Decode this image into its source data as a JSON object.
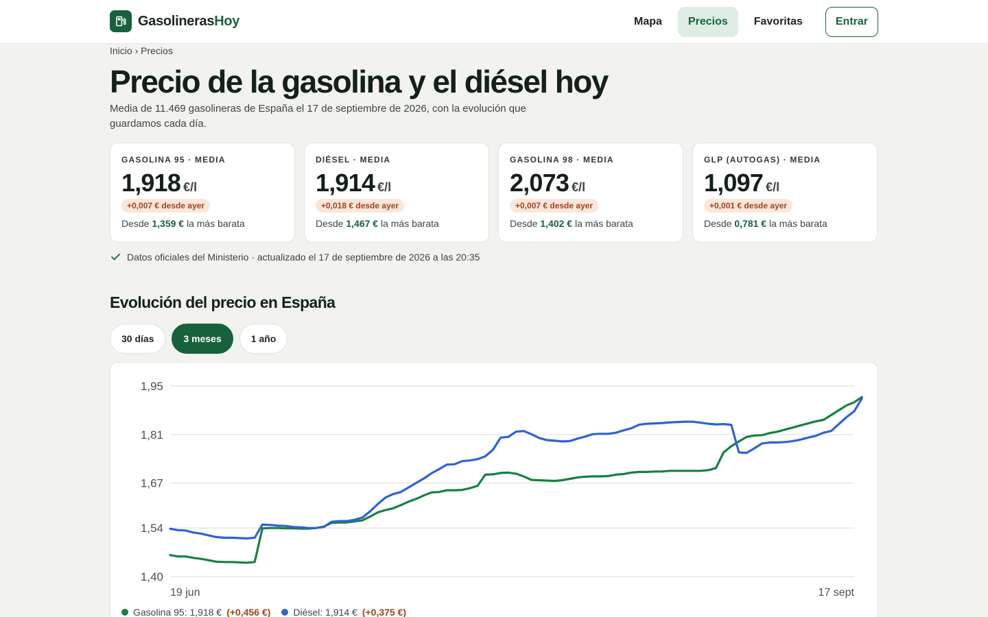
{
  "brand": {
    "name_part1": "Gasolineras",
    "name_part2": "Hoy"
  },
  "nav": {
    "items": [
      "Mapa",
      "Precios",
      "Favoritas"
    ],
    "active": "Precios",
    "login": "Entrar"
  },
  "breadcrumb": {
    "home": "Inicio",
    "separator": "›",
    "current": "Precios"
  },
  "header": {
    "title": "Precio de la gasolina y el diésel hoy",
    "subtitle": "Media de 11.469 gasolineras de España el 17 de septiembre de 2026, con la evolución que guardamos cada día."
  },
  "cards": [
    {
      "label": "GASOLINA 95 · MEDIA",
      "price": "1,918",
      "unit": "€/l",
      "delta": "+0,007 € desde ayer",
      "min_prefix": "Desde",
      "min_value": "1,359 €",
      "min_suffix": "la más barata"
    },
    {
      "label": "DIÉSEL · MEDIA",
      "price": "1,914",
      "unit": "€/l",
      "delta": "+0,018 € desde ayer",
      "min_prefix": "Desde",
      "min_value": "1,467 €",
      "min_suffix": "la más barata"
    },
    {
      "label": "GASOLINA 98 · MEDIA",
      "price": "2,073",
      "unit": "€/l",
      "delta": "+0,007 € desde ayer",
      "min_prefix": "Desde",
      "min_value": "1,402 €",
      "min_suffix": "la más barata"
    },
    {
      "label": "GLP (AUTOGAS) · MEDIA",
      "price": "1,097",
      "unit": "€/l",
      "delta": "+0,001 € desde ayer",
      "min_prefix": "Desde",
      "min_value": "0,781 €",
      "min_suffix": "la más barata"
    }
  ],
  "official_note": "Datos oficiales del Ministerio · actualizado el 17 de septiembre de 2026 a las 20:35",
  "section": {
    "title": "Evolución del precio en España"
  },
  "ranges": {
    "items": [
      "30 días",
      "3 meses",
      "1 año"
    ],
    "active": "3 meses"
  },
  "colors": {
    "accent": "#17623d",
    "gasolina95": "#17803f",
    "diesel": "#2e62d4",
    "delta": "#a2431a",
    "delta_bg": "#fbe6da"
  },
  "icons": {
    "brand": "fuel-pump-icon",
    "official": "check-icon"
  },
  "chart_data": {
    "type": "line",
    "yticks": [
      "1,95",
      "1,81",
      "1,67",
      "1,54",
      "1,40"
    ],
    "ylim": [
      1.4,
      1.95
    ],
    "x_start_label": "19 jun",
    "x_end_label": "17 sept",
    "x": [
      0,
      1,
      2,
      3,
      4,
      5,
      6,
      7,
      8,
      9,
      10,
      11,
      12,
      13,
      14,
      15,
      16,
      17,
      18,
      19,
      20,
      21,
      22,
      23,
      24,
      25,
      26,
      27,
      28,
      29,
      30,
      31,
      32,
      33,
      34,
      35,
      36,
      37,
      38,
      39,
      40,
      41,
      42,
      43,
      44,
      45,
      46,
      47,
      48,
      49,
      50,
      51,
      52,
      53,
      54,
      55,
      56,
      57,
      58,
      59,
      60,
      61,
      62,
      63,
      64,
      65,
      66,
      67,
      68,
      69,
      70,
      71,
      72,
      73,
      74,
      75,
      76,
      77,
      78,
      79,
      80,
      81,
      82,
      83,
      84,
      85,
      86,
      87,
      88,
      89
    ],
    "series": [
      {
        "name": "Gasolina 95",
        "color": "#17803f",
        "values": [
          1.462,
          1.458,
          1.458,
          1.454,
          1.451,
          1.447,
          1.443,
          1.442,
          1.442,
          1.441,
          1.44,
          1.442,
          1.539,
          1.54,
          1.54,
          1.539,
          1.539,
          1.538,
          1.538,
          1.54,
          1.544,
          1.555,
          1.556,
          1.556,
          1.559,
          1.562,
          1.573,
          1.585,
          1.592,
          1.597,
          1.606,
          1.616,
          1.624,
          1.634,
          1.643,
          1.644,
          1.649,
          1.649,
          1.65,
          1.655,
          1.662,
          1.694,
          1.695,
          1.699,
          1.7,
          1.697,
          1.689,
          1.679,
          1.678,
          1.677,
          1.676,
          1.678,
          1.682,
          1.686,
          1.688,
          1.689,
          1.689,
          1.69,
          1.694,
          1.696,
          1.7,
          1.702,
          1.702,
          1.703,
          1.703,
          1.705,
          1.705,
          1.705,
          1.705,
          1.705,
          1.707,
          1.713,
          1.758,
          1.776,
          1.79,
          1.803,
          1.807,
          1.808,
          1.814,
          1.818,
          1.824,
          1.83,
          1.836,
          1.842,
          1.848,
          1.852,
          1.866,
          1.88,
          1.894,
          1.903,
          1.918
        ]
      },
      {
        "name": "Diésel",
        "color": "#2e62d4",
        "values": [
          1.538,
          1.534,
          1.533,
          1.527,
          1.524,
          1.519,
          1.514,
          1.512,
          1.512,
          1.511,
          1.51,
          1.512,
          1.55,
          1.549,
          1.547,
          1.546,
          1.543,
          1.542,
          1.54,
          1.54,
          1.543,
          1.558,
          1.56,
          1.56,
          1.564,
          1.57,
          1.588,
          1.609,
          1.628,
          1.638,
          1.644,
          1.657,
          1.67,
          1.683,
          1.698,
          1.71,
          1.723,
          1.724,
          1.733,
          1.735,
          1.739,
          1.747,
          1.766,
          1.801,
          1.803,
          1.818,
          1.82,
          1.811,
          1.8,
          1.794,
          1.792,
          1.79,
          1.791,
          1.798,
          1.804,
          1.811,
          1.812,
          1.812,
          1.815,
          1.822,
          1.828,
          1.838,
          1.841,
          1.842,
          1.843,
          1.845,
          1.846,
          1.847,
          1.847,
          1.844,
          1.841,
          1.839,
          1.84,
          1.838,
          1.758,
          1.757,
          1.77,
          1.784,
          1.787,
          1.787,
          1.788,
          1.791,
          1.795,
          1.801,
          1.806,
          1.815,
          1.82,
          1.84,
          1.86,
          1.877,
          1.914
        ]
      }
    ]
  },
  "legend": [
    {
      "label": "Gasolina 95: 1,918 €",
      "change": "(+0,456 €)"
    },
    {
      "label": "Diésel: 1,914 €",
      "change": "(+0,375 €)"
    }
  ]
}
